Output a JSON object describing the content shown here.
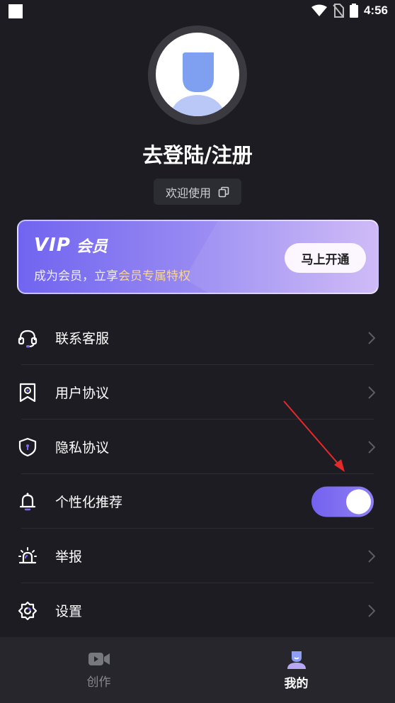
{
  "status_bar": {
    "time": "4:56"
  },
  "profile": {
    "title": "去登陆/注册",
    "welcome": "欢迎使用"
  },
  "vip": {
    "logo": "VIP",
    "title": "会员",
    "subtitle_prefix": "成为会员，立享",
    "subtitle_highlight": "会员专属特权",
    "button": "马上开通",
    "colors": {
      "start": "#7164f0",
      "end": "#cbb5f7",
      "highlight": "#f6d49a"
    }
  },
  "menu": {
    "items": [
      {
        "label": "联系客服",
        "icon": "headset-icon"
      },
      {
        "label": "用户协议",
        "icon": "bookmark-badge-icon"
      },
      {
        "label": "隐私协议",
        "icon": "shield-lock-icon"
      },
      {
        "label": "个性化推荐",
        "icon": "bell-icon",
        "toggle": true
      },
      {
        "label": "举报",
        "icon": "siren-icon"
      },
      {
        "label": "设置",
        "icon": "gear-icon"
      }
    ]
  },
  "tabbar": {
    "tabs": [
      {
        "label": "创作",
        "icon": "video-camera-icon",
        "active": false
      },
      {
        "label": "我的",
        "icon": "user-icon",
        "active": true
      }
    ]
  },
  "accent_color": "#7a6af0"
}
